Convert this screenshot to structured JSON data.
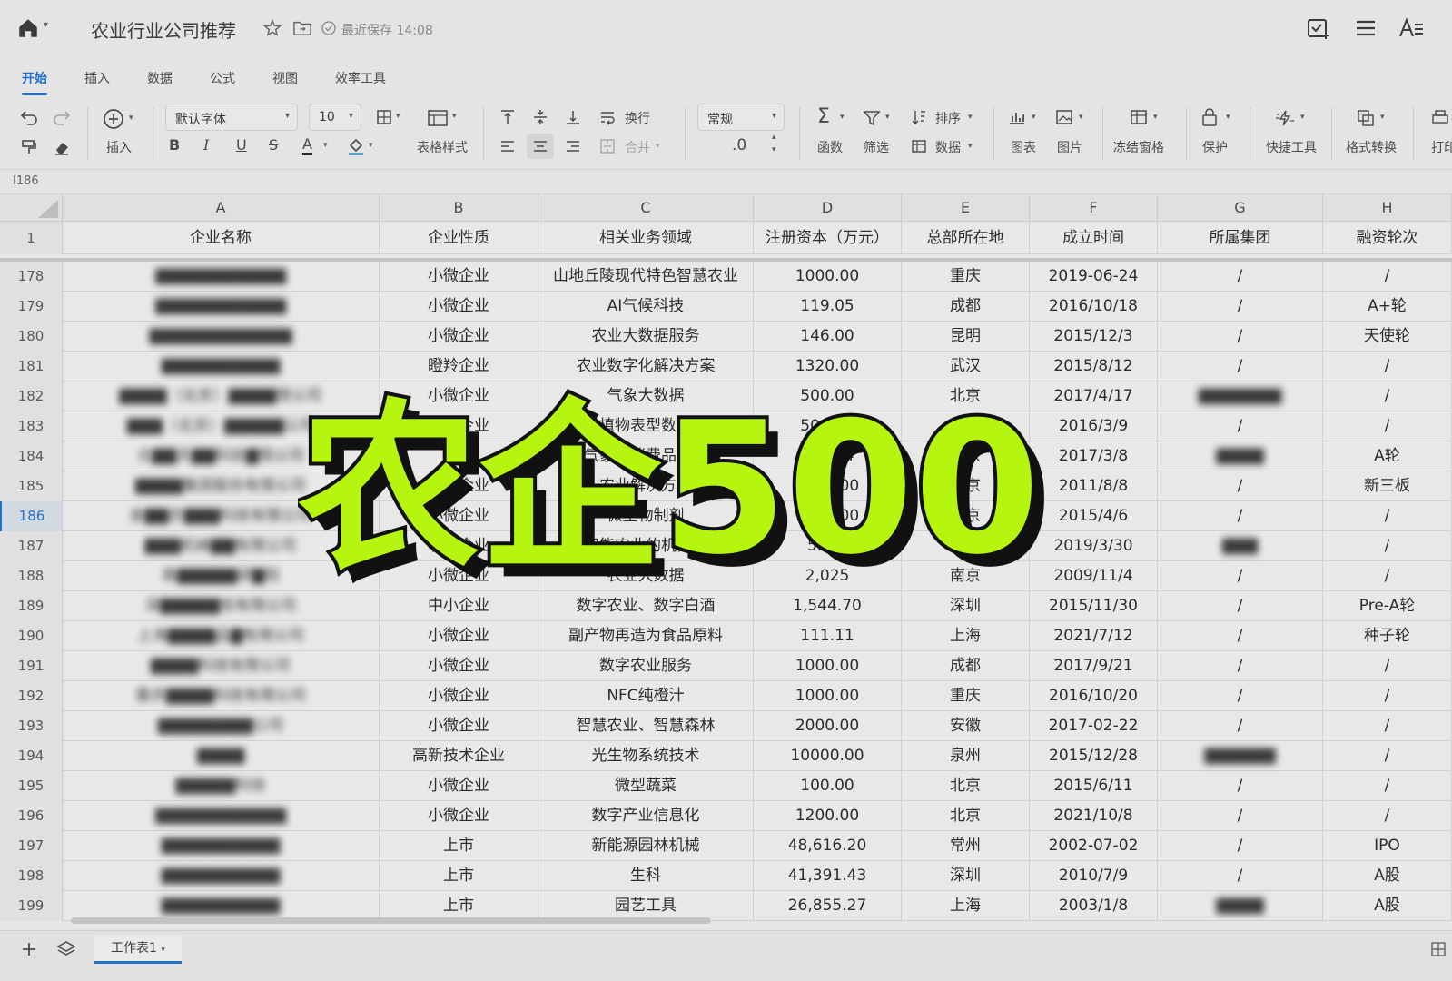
{
  "header": {
    "title": "农业行业公司推荐",
    "save_status": "最近保存 14:08"
  },
  "tabs": [
    "开始",
    "插入",
    "数据",
    "公式",
    "视图",
    "效率工具"
  ],
  "toolbar": {
    "insert_label": "插入",
    "font_name": "默认字体",
    "font_size": "10",
    "table_style_label": "表格样式",
    "wrap_label": "换行",
    "merge_label": "合并",
    "number_format": "常规",
    "decimal_label": ".0",
    "function_label": "函数",
    "filter_label": "筛选",
    "sort_label": "排序",
    "data_label": "数据",
    "chart_label": "图表",
    "image_label": "图片",
    "freeze_label": "冻结窗格",
    "protect_label": "保护",
    "quick_tools_label": "快捷工具",
    "format_convert_label": "格式转换",
    "print_label": "打印",
    "bold": "B",
    "italic": "I",
    "underline": "U",
    "strike": "S",
    "font_color": "A"
  },
  "formula_bar": {
    "cell_ref": "I186"
  },
  "columns": [
    "A",
    "B",
    "C",
    "D",
    "E",
    "F",
    "G",
    "H"
  ],
  "header_row": {
    "row_number": "1",
    "cells": [
      "企业名称",
      "企业性质",
      "相关业务领域",
      "注册资本（万元）",
      "总部所在地",
      "成立时间",
      "所属集团",
      "融资轮次"
    ]
  },
  "rows": [
    {
      "n": "178",
      "a": "▇▇▇▇▇▇▇▇▇▇▇",
      "b": "小微企业",
      "c": "山地丘陵现代特色智慧农业",
      "d": "1000.00",
      "e": "重庆",
      "f": "2019-06-24",
      "g": "/",
      "h": "/"
    },
    {
      "n": "179",
      "a": "▇▇▇▇▇▇▇▇▇▇▇",
      "b": "小微企业",
      "c": "AI气候科技",
      "d": "119.05",
      "e": "成都",
      "f": "2016/10/18",
      "g": "/",
      "h": "A+轮"
    },
    {
      "n": "180",
      "a": "▇▇▇▇▇▇▇▇▇▇▇▇",
      "b": "小微企业",
      "c": "农业大数据服务",
      "d": "146.00",
      "e": "昆明",
      "f": "2015/12/3",
      "g": "/",
      "h": "天使轮"
    },
    {
      "n": "181",
      "a": "▇▇▇▇▇▇▇▇▇▇",
      "b": "瞪羚企业",
      "c": "农业数字化解决方案",
      "d": "1320.00",
      "e": "武汉",
      "f": "2015/8/12",
      "g": "/",
      "h": "/"
    },
    {
      "n": "182",
      "a": "▇▇▇▇（北京）▇▇▇▇限公司",
      "b": "小微企业",
      "c": "气象大数据",
      "d": "500.00",
      "e": "北京",
      "f": "2017/4/17",
      "g": "▇▇▇▇▇▇▇",
      "h": "/"
    },
    {
      "n": "183",
      "a": "▇▇▇（北京）▇▇▇▇▇公司",
      "b": "小微企业",
      "c": "植物表型数据",
      "d": "500.00",
      "e": "北京",
      "f": "2016/3/9",
      "g": "/",
      "h": "/"
    },
    {
      "n": "184",
      "a": "北▇▇天▇▇科技▇限公司",
      "b": "国企",
      "c": "气象和消费品服务",
      "d": "189.14",
      "e": "北京",
      "f": "2017/3/8",
      "g": "▇▇▇▇",
      "h": "A轮"
    },
    {
      "n": "185",
      "a": "▇▇▇▇集团股份有限公司",
      "b": "上市企业",
      "c": "农业解决方案",
      "d": "5000.00",
      "e": "北京",
      "f": "2011/8/8",
      "g": "/",
      "h": "新三板"
    },
    {
      "n": "186",
      "a": "金▇▇农▇▇▇科技有限公司",
      "b": "小微企业",
      "c": "微生物制剂",
      "d": "1033.00",
      "e": "北京",
      "f": "2015/4/6",
      "g": "/",
      "h": "/"
    },
    {
      "n": "187",
      "a": "▇▇▇机械▇▇有限公司",
      "b": "小微企业",
      "c": "智能农业的机器人",
      "d": "5.6欧",
      "e": "南京",
      "f": "2019/3/30",
      "g": "▇▇▇",
      "h": "/"
    },
    {
      "n": "188",
      "a": "南▇▇▇▇▇研▇院",
      "b": "小微企业",
      "c": "农业大数据",
      "d": "2,025",
      "e": "南京",
      "f": "2009/11/4",
      "g": "/",
      "h": "/"
    },
    {
      "n": "189",
      "a": "深▇▇▇▇▇技有限公司",
      "b": "中小企业",
      "c": "数字农业、数字白酒",
      "d": "1,544.70",
      "e": "深圳",
      "f": "2015/11/30",
      "g": "/",
      "h": "Pre-A轮"
    },
    {
      "n": "190",
      "a": "上海▇▇▇▇品▇有限公司",
      "b": "小微企业",
      "c": "副产物再造为食品原料",
      "d": "111.11",
      "e": "上海",
      "f": "2021/7/12",
      "g": "/",
      "h": "种子轮"
    },
    {
      "n": "191",
      "a": "▇▇▇▇科技有限公司",
      "b": "小微企业",
      "c": "数字农业服务",
      "d": "1000.00",
      "e": "成都",
      "f": "2017/9/21",
      "g": "/",
      "h": "/"
    },
    {
      "n": "192",
      "a": "重庆▇▇▇▇科技有限公司",
      "b": "小微企业",
      "c": "NFC纯橙汁",
      "d": "1000.00",
      "e": "重庆",
      "f": "2016/10/20",
      "g": "/",
      "h": "/"
    },
    {
      "n": "193",
      "a": "▇▇▇▇▇▇▇▇公司",
      "b": "小微企业",
      "c": "智慧农业、智慧森林",
      "d": "2000.00",
      "e": "安徽",
      "f": "2017-02-22",
      "g": "/",
      "h": "/"
    },
    {
      "n": "194",
      "a": "▇▇▇▇",
      "b": "高新技术企业",
      "c": "光生物系统技术",
      "d": "10000.00",
      "e": "泉州",
      "f": "2015/12/28",
      "g": "▇▇▇▇▇▇",
      "h": "/"
    },
    {
      "n": "195",
      "a": "▇▇▇▇▇科技",
      "b": "小微企业",
      "c": "微型蔬菜",
      "d": "100.00",
      "e": "北京",
      "f": "2015/6/11",
      "g": "/",
      "h": "/"
    },
    {
      "n": "196",
      "a": "▇▇▇▇▇▇▇▇▇▇▇",
      "b": "小微企业",
      "c": "数字产业信息化",
      "d": "1200.00",
      "e": "北京",
      "f": "2021/10/8",
      "g": "/",
      "h": "/"
    },
    {
      "n": "197",
      "a": "▇▇▇▇▇▇▇▇▇▇",
      "b": "上市",
      "c": "新能源园林机械",
      "d": "48,616.20",
      "e": "常州",
      "f": "2002-07-02",
      "g": "/",
      "h": "IPO"
    },
    {
      "n": "198",
      "a": "▇▇▇▇▇▇▇▇▇▇",
      "b": "上市",
      "c": "生科",
      "d": "41,391.43",
      "e": "深圳",
      "f": "2010/7/9",
      "g": "/",
      "h": "A股"
    },
    {
      "n": "199",
      "a": "▇▇▇▇▇▇▇▇▇▇",
      "b": "上市",
      "c": "园艺工具",
      "d": "26,855.27",
      "e": "上海",
      "f": "2003/1/8",
      "g": "▇▇▇▇",
      "h": "A股"
    }
  ],
  "overlay": {
    "text": "农企500"
  },
  "bottom": {
    "sheet_tab": "工作表1"
  },
  "colors": {
    "accent": "#1b6fd8",
    "overlay_fill": "#b6f50f",
    "overlay_stroke": "#111111"
  }
}
